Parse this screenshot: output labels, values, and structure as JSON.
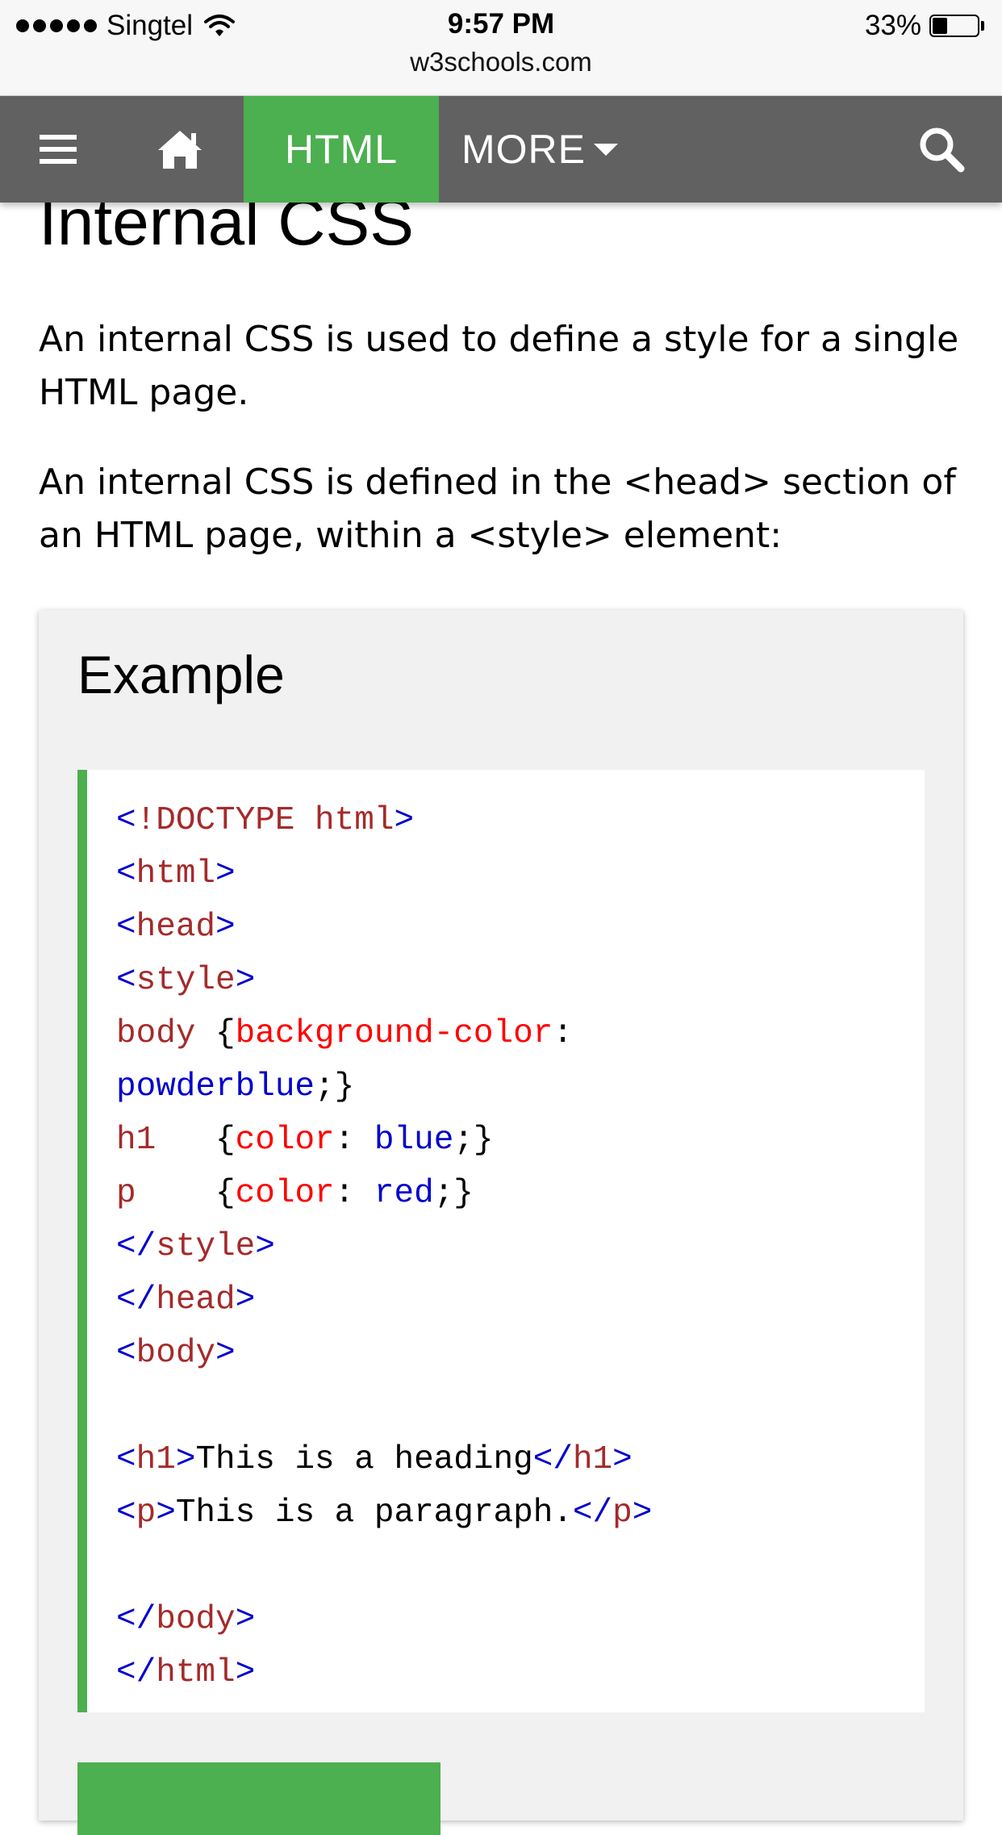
{
  "status_bar": {
    "carrier": "Singtel",
    "time": "9:57 PM",
    "url": "w3schools.com",
    "battery_percent": "33%",
    "battery_level": 0.33
  },
  "navbar": {
    "bg_color": "#616161",
    "accent_color": "#4caf50",
    "icons": [
      "menu-icon",
      "home-icon",
      "caret-down-icon",
      "search-icon"
    ],
    "active_tab": "HTML",
    "more_label": "MORE"
  },
  "main": {
    "heading": "Internal CSS",
    "paragraphs": [
      "An internal CSS is used to define a style for a single HTML page.",
      "An internal CSS is defined in the <head> section of an HTML page, within a <style> element:"
    ],
    "example": {
      "title": "Example",
      "code": {
        "doctype_open": "<",
        "doctype": "!DOCTYPE html",
        "html_open": "html",
        "head_open": "head",
        "style_open": "style",
        "body_selector": "body",
        "bg_prop": "background-color",
        "bg_value": "powderblue",
        "h1_selector": "h1",
        "p_selector": "p",
        "color_prop": "color",
        "blue_value": "blue",
        "red_value": "red",
        "style_close": "style",
        "head_close": "head",
        "body_open": "body",
        "h1_tag": "h1",
        "h1_text": "This is a heading",
        "p_tag": "p",
        "p_text": "This is a paragraph.",
        "body_close": "body",
        "html_close": "html"
      }
    }
  }
}
